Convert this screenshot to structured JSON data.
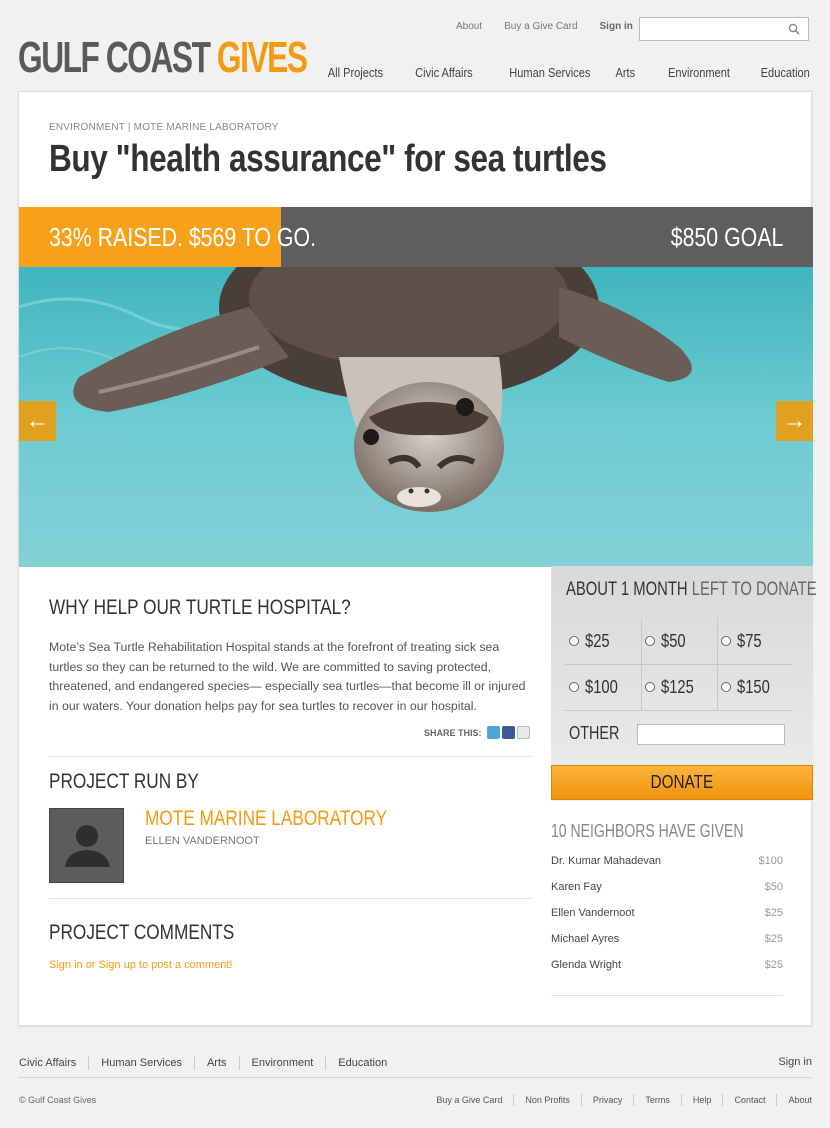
{
  "header": {
    "logo_part1": "GULF COAST",
    "logo_part2": "GIVES",
    "util_nav": [
      "About",
      "Buy a Give Card",
      "Sign in"
    ],
    "main_nav": [
      "All Projects",
      "Civic Affairs",
      "Human Services",
      "Arts",
      "Environment",
      "Education"
    ]
  },
  "project": {
    "breadcrumb": "ENVIRONMENT | MOTE MARINE LABORATORY",
    "title": "Buy \"health assurance\" for sea turtles",
    "progress_fraction": 0.33,
    "raised_text": "33% RAISED. $569 TO GO.",
    "goal_text": "$850 GOAL"
  },
  "why": {
    "heading": "WHY HELP OUR TURTLE HOSPITAL?",
    "body": "Mote’s Sea Turtle Rehabilitation Hospital stands at the forefront of treating sick sea turtles so they can be returned to the wild. We are committed to saving protected, threatened, and endangered species— especially sea turtles—that become ill or injured in our waters. Your donation helps pay for sea turtles to recover in our hospital.",
    "share_label": "SHARE THIS:"
  },
  "run_by": {
    "heading": "PROJECT RUN BY",
    "org": "MOTE MARINE LABORATORY",
    "person": "ELLEN VANDERNOOT"
  },
  "comments": {
    "heading": "PROJECT COMMENTS",
    "link": "Sign in or Sign up to post a comment!"
  },
  "donate": {
    "time_bold": "ABOUT 1 MONTH",
    "time_light": "LEFT TO DONATE",
    "amounts": [
      "$25",
      "$50",
      "$75",
      "$100",
      "$125",
      "$150"
    ],
    "other_label": "OTHER",
    "button": "DONATE"
  },
  "neighbors": {
    "heading": "10 NEIGHBORS HAVE GIVEN",
    "donors": [
      {
        "name": "Dr. Kumar Mahadevan",
        "amount": "$100"
      },
      {
        "name": "Karen Fay",
        "amount": "$50"
      },
      {
        "name": "Ellen Vandernoot",
        "amount": "$25"
      },
      {
        "name": "Michael Ayres",
        "amount": "$25"
      },
      {
        "name": "Glenda Wright",
        "amount": "$25"
      }
    ]
  },
  "footer": {
    "nav": [
      "Civic Affairs",
      "Human Services",
      "Arts",
      "Environment",
      "Education"
    ],
    "signin": "Sign in",
    "copyright": "© Gulf Coast Gives",
    "links": [
      "Buy a Give Card",
      "Non Profits",
      "Privacy",
      "Terms",
      "Help",
      "Contact",
      "About"
    ]
  },
  "colors": {
    "accent": "#f29a10",
    "progress_fill": "#f7a11a",
    "progress_bg": "#5e5e5e",
    "arrow": "#e0a020"
  }
}
